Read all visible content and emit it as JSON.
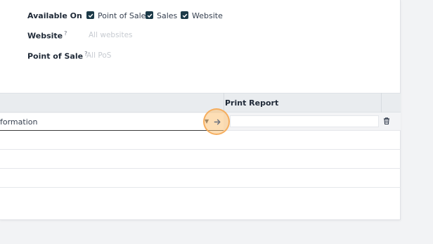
{
  "form": {
    "available_on": {
      "label": "Available On",
      "options": [
        {
          "label": "Point of Sale",
          "checked": true
        },
        {
          "label": "Sales",
          "checked": true
        },
        {
          "label": "Website",
          "checked": true
        }
      ]
    },
    "website": {
      "label": "Website",
      "help": "?",
      "placeholder": "All websites"
    },
    "point_of_sale": {
      "label": "Point of Sale",
      "help": "?",
      "placeholder": "All PoS"
    }
  },
  "table": {
    "columns": [
      {
        "label": ""
      },
      {
        "label": "Print Report"
      }
    ],
    "editing_row": {
      "field_value": "formation",
      "print_report_value": ""
    }
  },
  "icons": {
    "checkbox": "check-icon",
    "dropdown": "caret-down-icon",
    "open_record": "arrow-right-icon",
    "delete": "trash-icon"
  },
  "colors": {
    "checkbox": "#1c3a48",
    "focus_highlight": "#fcc278",
    "header_bg": "#e9ecef"
  }
}
